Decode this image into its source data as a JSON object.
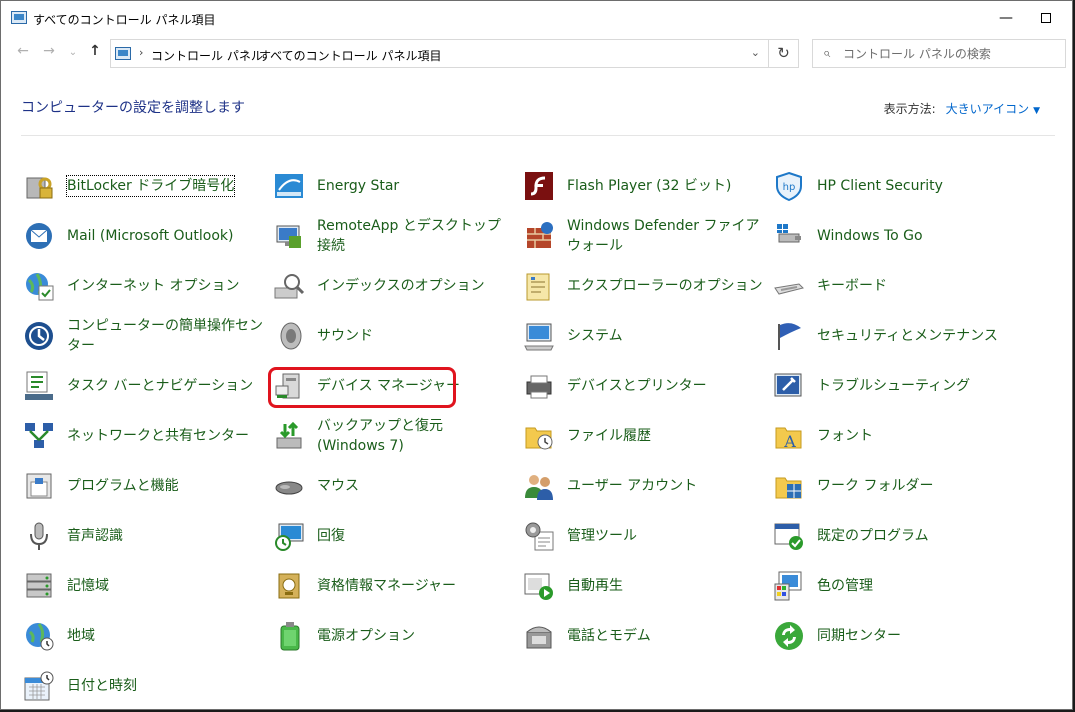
{
  "window": {
    "title": "すべてのコントロール パネル項目"
  },
  "address": {
    "crumbs": [
      "コントロール パネル",
      "すべてのコントロール パネル項目"
    ],
    "search_placeholder": "コントロール パネルの検索"
  },
  "header": {
    "title": "コンピューターの設定を調整します",
    "view_label": "表示方法:",
    "view_value": "大きいアイコン"
  },
  "items": [
    {
      "label": "BitLocker ドライブ暗号化",
      "icon": "bitlocker-icon"
    },
    {
      "label": "Energy Star",
      "icon": "energy-star-icon"
    },
    {
      "label": "Flash Player (32 ビット)",
      "icon": "flash-player-icon"
    },
    {
      "label": "HP Client Security",
      "icon": "hp-client-security-icon"
    },
    {
      "label": "Mail (Microsoft Outlook)",
      "icon": "mail-icon"
    },
    {
      "label": "RemoteApp とデスクトップ接続",
      "icon": "remoteapp-icon"
    },
    {
      "label": "Windows Defender ファイアウォール",
      "icon": "firewall-icon"
    },
    {
      "label": "Windows To Go",
      "icon": "windows-to-go-icon"
    },
    {
      "label": "インターネット オプション",
      "icon": "internet-options-icon"
    },
    {
      "label": "インデックスのオプション",
      "icon": "indexing-icon"
    },
    {
      "label": "エクスプローラーのオプション",
      "icon": "explorer-options-icon"
    },
    {
      "label": "キーボード",
      "icon": "keyboard-icon"
    },
    {
      "label": "コンピューターの簡単操作センター",
      "icon": "ease-of-access-icon"
    },
    {
      "label": "サウンド",
      "icon": "sound-icon"
    },
    {
      "label": "システム",
      "icon": "system-icon"
    },
    {
      "label": "セキュリティとメンテナンス",
      "icon": "security-maintenance-icon"
    },
    {
      "label": "タスク バーとナビゲーション",
      "icon": "taskbar-icon"
    },
    {
      "label": "デバイス マネージャー",
      "icon": "device-manager-icon"
    },
    {
      "label": "デバイスとプリンター",
      "icon": "devices-printers-icon"
    },
    {
      "label": "トラブルシューティング",
      "icon": "troubleshooting-icon"
    },
    {
      "label": "ネットワークと共有センター",
      "icon": "network-icon"
    },
    {
      "label": "バックアップと復元 (Windows 7)",
      "icon": "backup-icon"
    },
    {
      "label": "ファイル履歴",
      "icon": "file-history-icon"
    },
    {
      "label": "フォント",
      "icon": "fonts-icon"
    },
    {
      "label": "プログラムと機能",
      "icon": "programs-icon"
    },
    {
      "label": "マウス",
      "icon": "mouse-icon"
    },
    {
      "label": "ユーザー アカウント",
      "icon": "user-accounts-icon"
    },
    {
      "label": "ワーク フォルダー",
      "icon": "work-folders-icon"
    },
    {
      "label": "音声認識",
      "icon": "speech-icon"
    },
    {
      "label": "回復",
      "icon": "recovery-icon"
    },
    {
      "label": "管理ツール",
      "icon": "admin-tools-icon"
    },
    {
      "label": "既定のプログラム",
      "icon": "default-programs-icon"
    },
    {
      "label": "記憶域",
      "icon": "storage-icon"
    },
    {
      "label": "資格情報マネージャー",
      "icon": "credential-manager-icon"
    },
    {
      "label": "自動再生",
      "icon": "autoplay-icon"
    },
    {
      "label": "色の管理",
      "icon": "color-management-icon"
    },
    {
      "label": "地域",
      "icon": "region-icon"
    },
    {
      "label": "電源オプション",
      "icon": "power-icon"
    },
    {
      "label": "電話とモデム",
      "icon": "phone-modem-icon"
    },
    {
      "label": "同期センター",
      "icon": "sync-center-icon"
    },
    {
      "label": "日付と時刻",
      "icon": "date-time-icon"
    }
  ],
  "colors": {
    "link": "#1a5d1a",
    "header": "#1e3287",
    "accent": "#0066cc",
    "highlight": "#e0141e"
  }
}
